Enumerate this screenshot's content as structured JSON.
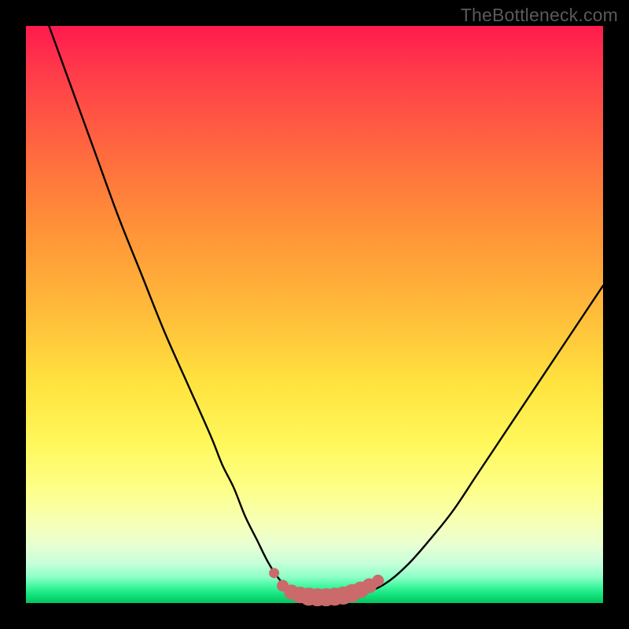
{
  "watermark": "TheBottleneck.com",
  "colors": {
    "curve": "#000000",
    "marker_fill": "#cb6a6a",
    "marker_stroke": "#cb6a6a"
  },
  "chart_data": {
    "type": "line",
    "title": "",
    "xlabel": "",
    "ylabel": "",
    "xlim": [
      0,
      100
    ],
    "ylim": [
      0,
      100
    ],
    "grid": false,
    "series": [
      {
        "name": "bottleneck-curve",
        "x": [
          4,
          8,
          12,
          16,
          20,
          24,
          28,
          32,
          34,
          36,
          38,
          40,
          42,
          44,
          46,
          48,
          50,
          54,
          58,
          62,
          66,
          70,
          74,
          78,
          82,
          86,
          90,
          94,
          98,
          100
        ],
        "y": [
          100,
          89,
          78,
          67,
          57,
          47,
          38,
          29,
          24,
          20,
          15,
          11,
          7,
          4,
          2.2,
          1.4,
          1.2,
          1.2,
          1.6,
          3.2,
          6.5,
          11,
          16,
          22,
          28,
          34,
          40,
          46,
          52,
          55
        ]
      }
    ],
    "markers": {
      "name": "valley-markers",
      "x": [
        43.0,
        44.5,
        46.0,
        47.5,
        49.0,
        50.5,
        52.0,
        53.5,
        55.0,
        56.5,
        58.0,
        59.5,
        61.0
      ],
      "y": [
        5.2,
        3.0,
        1.9,
        1.4,
        1.1,
        1.0,
        1.0,
        1.1,
        1.3,
        1.7,
        2.3,
        3.0,
        3.9
      ],
      "r": [
        6,
        7,
        9,
        10,
        11,
        11,
        11,
        11,
        11,
        11,
        10,
        9,
        7
      ]
    }
  }
}
